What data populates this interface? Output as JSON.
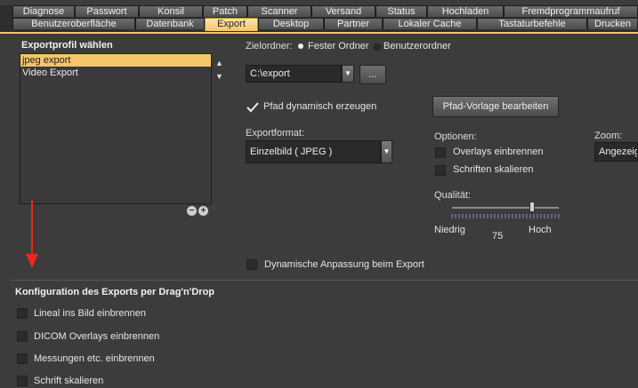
{
  "tabs_row1": [
    "Diagnose",
    "Passwort",
    "Konsil",
    "Patch",
    "Scanner",
    "Versand",
    "Status",
    "Hochladen",
    "Fremdprogrammaufruf"
  ],
  "tabs_row2": [
    "Benutzeroberfläche",
    "Datenbank",
    "Export",
    "Desktop",
    "Partner",
    "Lokaler Cache",
    "Tastaturbefehle",
    "Drucken"
  ],
  "active_tab": "Export",
  "profile": {
    "title": "Exportprofil wählen",
    "items": [
      "jpeg export",
      "Video Export"
    ],
    "selected": "jpeg export",
    "remove_label": "−",
    "add_label": "+"
  },
  "target": {
    "label": "Zielordner:",
    "option_fixed": "Fester Ordner",
    "option_user": "Benutzerordner",
    "path_value": "C:\\export",
    "browse_label": "..."
  },
  "dynamic_path": {
    "label": "Pfad dynamisch erzeugen",
    "checked": true
  },
  "template_button": "Pfad-Vorlage bearbeiten",
  "format": {
    "label": "Exportformat:",
    "value": "Einzelbild ( JPEG )"
  },
  "options": {
    "label": "Optionen:",
    "burn_overlays": "Overlays einbrennen",
    "scale_fonts": "Schriften skalieren"
  },
  "zoom": {
    "label": "Zoom:",
    "value": "Angezeigt"
  },
  "quality": {
    "label": "Qualität:",
    "low": "Niedrig",
    "high": "Hoch",
    "value": "75",
    "value_num": 75
  },
  "dynamic_adjust": "Dynamische Anpassung beim Export",
  "dragdrop": {
    "title": "Konfiguration des Exports per Drag'n'Drop",
    "items": [
      "Lineal ins Bild einbrennen",
      "DICOM Overlays einbrennen",
      "Messungen etc. einbrennen",
      "Schrift skalieren"
    ]
  },
  "colors": {
    "accent": "#f5c56a",
    "background": "#3c3c3c",
    "arrow": "#e8281e"
  }
}
